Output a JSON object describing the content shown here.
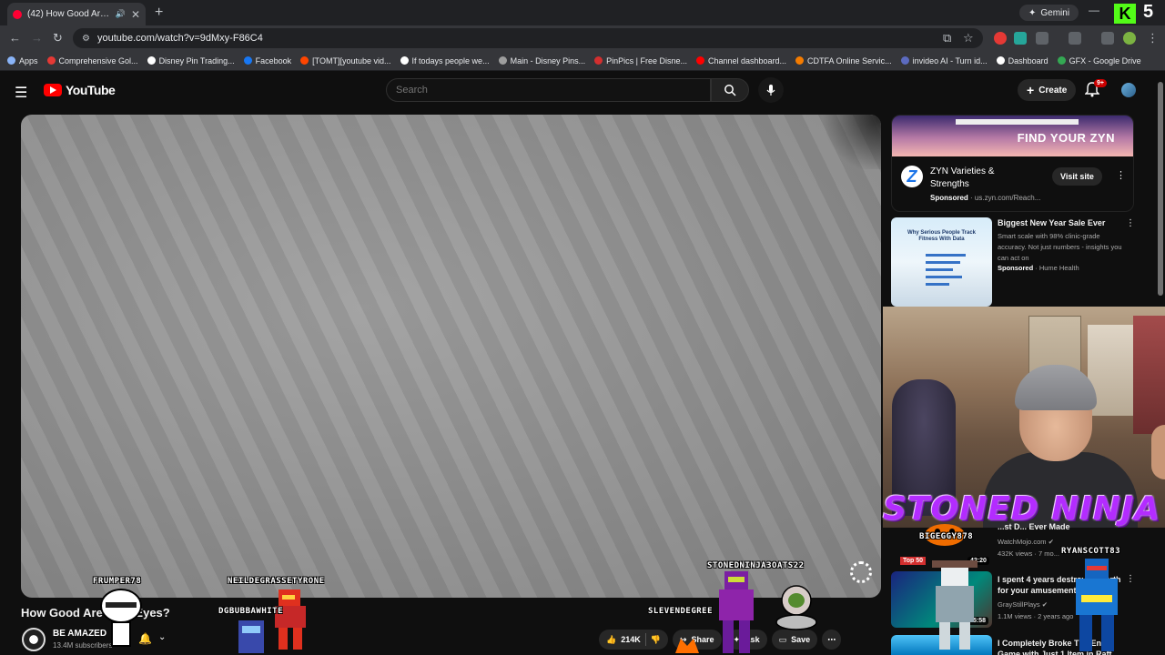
{
  "browser": {
    "tab_title": "(42) How Good Are Your Ey...",
    "new_tab_label": "+",
    "gemini_label": "Gemini",
    "url": "youtube.com/watch?v=9dMxy-F86C4",
    "bookmarks": [
      {
        "label": "Apps",
        "color": "#8ab4f8"
      },
      {
        "label": "Comprehensive Gol...",
        "color": "#e53935"
      },
      {
        "label": "Disney Pin Trading...",
        "color": "#ffffff"
      },
      {
        "label": "Facebook",
        "color": "#1877f2"
      },
      {
        "label": "[TOMT][youtube vid...",
        "color": "#ff4500"
      },
      {
        "label": "If todays people we...",
        "color": "#ffffff"
      },
      {
        "label": "Main - Disney Pins...",
        "color": "#9e9e9e"
      },
      {
        "label": "PinPics | Free Disne...",
        "color": "#d32f2f"
      },
      {
        "label": "Channel dashboard...",
        "color": "#ff0000"
      },
      {
        "label": "CDTFA Online Servic...",
        "color": "#f57c00"
      },
      {
        "label": "invideo AI - Turn id...",
        "color": "#5c6bc0"
      },
      {
        "label": "Dashboard",
        "color": "#ffffff"
      },
      {
        "label": "GFX - Google Drive",
        "color": "#34a853"
      }
    ]
  },
  "youtube": {
    "logo_text": "YouTube",
    "search_placeholder": "Search",
    "create_label": "Create",
    "notif_count": "9+"
  },
  "video": {
    "title": "How Good Are Your Eyes?",
    "channel": "BE AMAZED",
    "subscribers": "13.4M subscribers",
    "likes": "214K",
    "share_label": "Share",
    "ask_label": "Ask",
    "save_label": "Save",
    "overlay_names": {
      "n1": "FRUMPER78",
      "n2": "NEILDEGRASSETYRONE",
      "n3": "DGBUBBAWHITE",
      "n4": "STONEDNINJA3OATS22",
      "n5": "SLEVENDEGREE",
      "n6": "BIGEGGY878",
      "n7": "RYANSCOTT83"
    }
  },
  "sidebar": {
    "ad1": {
      "banner_text": "FIND YOUR ZYN",
      "headline": "ZYN Varieties & Strengths",
      "sponsored": "Sponsored",
      "domain": "· us.zyn.com/Reach...",
      "cta": "Visit site"
    },
    "ad2": {
      "thumb_text": "Why Serious People Track Fitness With Data",
      "title": "Biggest New Year Sale Ever",
      "desc": "Smart scale with 98% clinic-grade accuracy. Not just numbers - insights you can act on",
      "sponsored": "Sponsored",
      "advertiser": "· Hume Health"
    },
    "webcam_banner": "STONED NINJA",
    "recs": [
      {
        "title": "...st D... Ever Made",
        "channel": "WatchMojo.com",
        "meta": "432K views · 7 mo...",
        "duration": "42:20",
        "badge": "Top 50"
      },
      {
        "title": "I spent 4 years destroying earth for your amusement",
        "channel": "GrayStillPlays",
        "meta": "1.1M views · 2 years ago",
        "duration": "1:35:58"
      },
      {
        "title": "I Completely Broke The Entire Game with Just 1 Item in Raft",
        "channel": "",
        "meta": "",
        "duration": ""
      }
    ]
  },
  "colors": {
    "background": "#0f0f0f",
    "accent_red": "#ff0000",
    "neon_purple": "#b32cff"
  }
}
